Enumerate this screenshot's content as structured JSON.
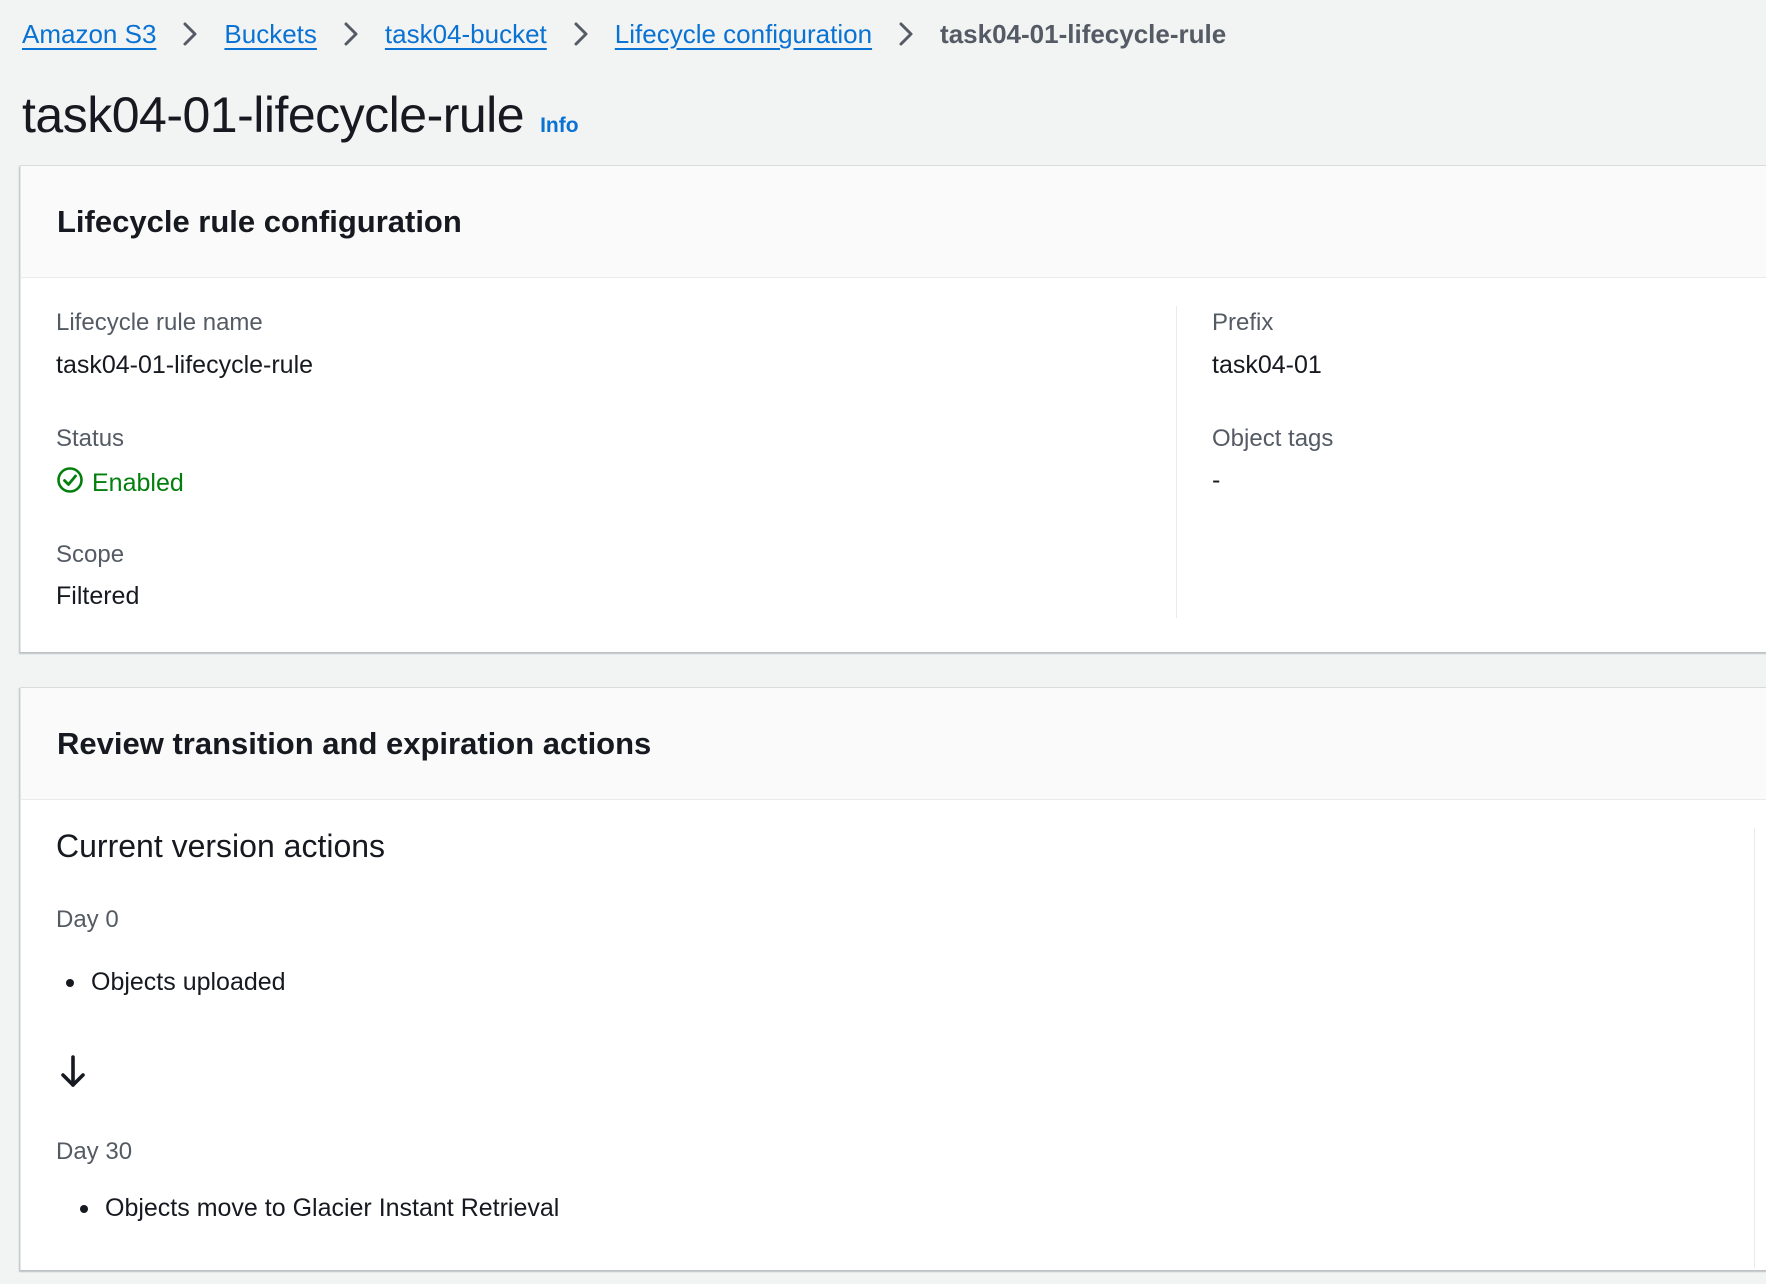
{
  "breadcrumb": {
    "items": [
      "Amazon S3",
      "Buckets",
      "task04-bucket",
      "Lifecycle configuration"
    ],
    "current": "task04-01-lifecycle-rule"
  },
  "page": {
    "title": "task04-01-lifecycle-rule",
    "info_label": "Info"
  },
  "config_panel": {
    "heading": "Lifecycle rule configuration",
    "rule_name_label": "Lifecycle rule name",
    "rule_name_value": "task04-01-lifecycle-rule",
    "status_label": "Status",
    "status_value": "Enabled",
    "scope_label": "Scope",
    "scope_value": "Filtered",
    "prefix_label": "Prefix",
    "prefix_value": "task04-01",
    "object_tags_label": "Object tags",
    "object_tags_value": "-"
  },
  "review_panel": {
    "heading": "Review transition and expiration actions",
    "section_title": "Current version actions",
    "day0_label": "Day 0",
    "day0_action": "Objects uploaded",
    "day30_label": "Day 30",
    "day30_action": "Objects move to Glacier Instant Retrieval"
  },
  "icons": {
    "status_icon": "check-circle-icon",
    "separator_icon": "chevron-right-icon",
    "flow_icon": "arrow-down-icon"
  },
  "colors": {
    "link": "#0972d3",
    "success": "#037f0c",
    "text": "#16191f",
    "label": "#545b64",
    "background": "#f2f3f3"
  }
}
